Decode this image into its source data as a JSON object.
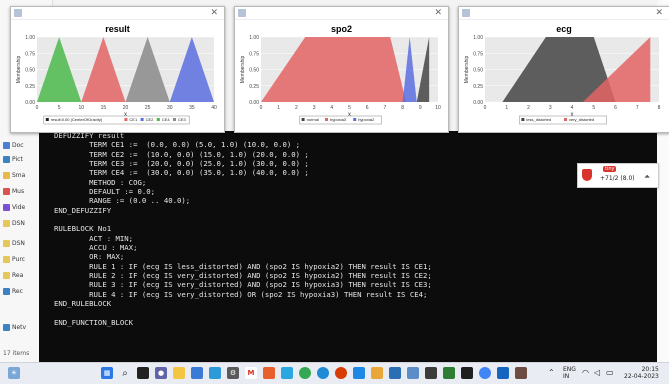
{
  "explorer": {
    "items": [
      {
        "label": "Doc",
        "color": "#4a7fd4"
      },
      {
        "label": "Pict",
        "color": "#3b82c4"
      },
      {
        "label": "Sma",
        "color": "#e8b84a"
      },
      {
        "label": "Mus",
        "color": "#d9534f"
      },
      {
        "label": "Vide",
        "color": "#7b4fd4"
      },
      {
        "label": "DSN",
        "color": "#e8c75a"
      },
      {
        "label": "DSN",
        "color": "#e8c75a"
      },
      {
        "label": "Purc",
        "color": "#e8c75a"
      },
      {
        "label": "Rea",
        "color": "#e8c75a"
      },
      {
        "label": "Rec",
        "color": "#3b82c4"
      },
      {
        "label": "Netv",
        "color": "#3b82c4"
      }
    ],
    "count": "17 items"
  },
  "code_lines": [
    "DEFUZZIFY result",
    "        TERM CE1 :=  (0.0, 0.0) (5.0, 1.0) (10.0, 0.0) ;",
    "        TERM CE2 :=  (10.0, 0.0) (15.0, 1.0) (20.0, 0.0) ;",
    "        TERM CE3 :=  (20.0, 0.0) (25.0, 1.0) (30.0, 0.0) ;",
    "        TERM CE4 :=  (30.0, 0.0) (35.0, 1.0) (40.0, 0.0) ;",
    "        METHOD : COG;",
    "        DEFAULT := 0.0;",
    "        RANGE := (0.0 .. 40.0);",
    "END_DEFUZZIFY",
    "",
    "RULEBLOCK No1",
    "        ACT : MIN;",
    "        ACCU : MAX;",
    "        OR: MAX;",
    "        RULE 1 : IF (ecg IS less_distorted) AND (spo2 IS hypoxia2) THEN result IS CE1;",
    "        RULE 2 : IF (ecg IS very_distorted) AND (spo2 IS hypoxia2) THEN result IS CE2;",
    "        RULE 3 : IF (ecg IS very_distorted) AND (spo2 IS hypoxia3) THEN result IS CE3;",
    "        RULE 4 : IF (ecg IS very_distorted) OR (spo2 IS hypoxia3) THEN result IS CE4;",
    "END_RULEBLOCK",
    "",
    "END_FUNCTION_BLOCK"
  ],
  "charts": [
    {
      "title": "result",
      "ylabel": "Membership",
      "xlabel": "x",
      "xticks": [
        "0",
        "5",
        "10",
        "15",
        "20",
        "25",
        "30",
        "35",
        "40"
      ],
      "yticks": [
        "0.00",
        "0.25",
        "0.50",
        "0.75",
        "1.00"
      ],
      "legend": [
        {
          "label": "result:0.00 (CenterOfGravity)",
          "color": "#222222"
        },
        {
          "label": "CE1",
          "color": "#e36464"
        },
        {
          "label": "CE2",
          "color": "#5b6ee0"
        },
        {
          "label": "CE4",
          "color": "#4bb84b"
        },
        {
          "label": "CE3",
          "color": "#8a8a8a"
        }
      ]
    },
    {
      "title": "spo2",
      "ylabel": "Membership",
      "xlabel": "x",
      "xticks": [
        "0",
        "1",
        "2",
        "3",
        "4",
        "5",
        "6",
        "7",
        "8",
        "9",
        "10"
      ],
      "yticks": [
        "0.00",
        "0.25",
        "0.50",
        "0.75",
        "1.00"
      ],
      "legend": [
        {
          "label": "normal",
          "color": "#444444"
        },
        {
          "label": "hypoxia3",
          "color": "#e36464"
        },
        {
          "label": "hypoxia2",
          "color": "#5b6ee0"
        }
      ]
    },
    {
      "title": "ecg",
      "ylabel": "Membership",
      "xlabel": "x",
      "xticks": [
        "0",
        "1",
        "2",
        "3",
        "4",
        "5",
        "6",
        "7",
        "8"
      ],
      "yticks": [
        "0.00",
        "0.25",
        "0.50",
        "0.75",
        "1.00"
      ],
      "legend": [
        {
          "label": "less_distorted",
          "color": "#444444"
        },
        {
          "label": "very_distorted",
          "color": "#e36464"
        }
      ]
    }
  ],
  "widget": {
    "badge": "tiny",
    "reading": "+71/2 (8.0)"
  },
  "taskbar": {
    "lang": "ENG",
    "region": "IN",
    "time": "20:15",
    "date": "22-04-2023"
  }
}
